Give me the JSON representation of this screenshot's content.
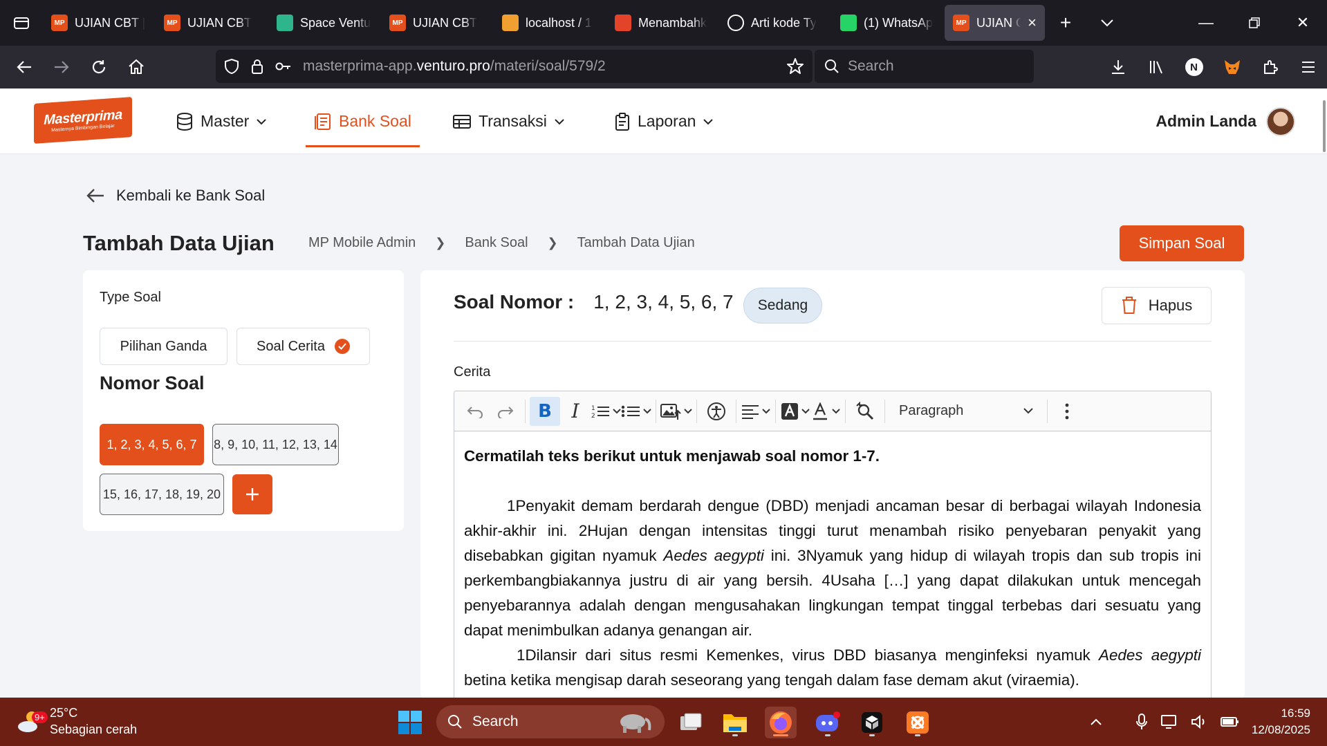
{
  "browser": {
    "tabs": [
      {
        "title": "UJIAN CBT |",
        "icon": "mp-favicon",
        "color": "#e3501b",
        "active": false
      },
      {
        "title": "UJIAN CBT",
        "icon": "mp-favicon",
        "color": "#e3501b",
        "active": false
      },
      {
        "title": "Space Ventu",
        "icon": "space-favicon",
        "color": "#2fb58c",
        "active": false
      },
      {
        "title": "UJIAN CBT",
        "icon": "mp-favicon",
        "color": "#e3501b",
        "active": false
      },
      {
        "title": "localhost / 1",
        "icon": "phpmyadmin-favicon",
        "color": "#f0a030",
        "active": false
      },
      {
        "title": "Menambahk",
        "icon": "gitlab-favicon",
        "color": "#e24329",
        "active": false
      },
      {
        "title": "Arti kode Ty",
        "icon": "openai-favicon",
        "color": "#ffffff",
        "active": false
      },
      {
        "title": "(1) WhatsAp",
        "icon": "whatsapp-favicon",
        "color": "#25d366",
        "active": false
      },
      {
        "title": "UJIAN CBT",
        "icon": "mp-favicon",
        "color": "#e3501b",
        "active": true
      }
    ],
    "url_host": "masterprima-app.",
    "url_domain": "venturo.pro",
    "url_path": "/materi/soal/579/2",
    "search_placeholder": "Search"
  },
  "app": {
    "logo_text": "Masterprima",
    "logo_tagline": "Masternya Bimbingan Belajar",
    "menu": [
      {
        "label": "Master",
        "icon": "database-icon",
        "has_dropdown": true
      },
      {
        "label": "Bank Soal",
        "icon": "document-icon",
        "active": true
      },
      {
        "label": "Transaksi",
        "icon": "table-icon",
        "has_dropdown": true
      },
      {
        "label": "Laporan",
        "icon": "clipboard-icon",
        "has_dropdown": true
      }
    ],
    "user_name": "Admin Landa",
    "accent": "#e3501b"
  },
  "page": {
    "back_label": "Kembali ke Bank Soal",
    "title": "Tambah Data Ujian",
    "breadcrumb": [
      "MP Mobile Admin",
      "Bank Soal",
      "Tambah Data Ujian"
    ],
    "save_label": "Simpan Soal"
  },
  "left": {
    "type_label": "Type Soal",
    "type_options": [
      {
        "label": "Pilihan Ganda",
        "selected": false
      },
      {
        "label": "Soal Cerita",
        "selected": true
      }
    ],
    "nomor_title": "Nomor Soal",
    "groups": [
      {
        "label": "1, 2, 3, 4, 5, 6, 7",
        "active": true
      },
      {
        "label": "8, 9, 10, 11, 12, 13, 14",
        "active": false
      },
      {
        "label": "15, 16, 17, 18, 19, 20",
        "active": false
      }
    ]
  },
  "right": {
    "soal_label": "Soal Nomor :",
    "soal_numbers": "1, 2, 3, 4, 5, 6, 7",
    "difficulty": "Sedang",
    "delete_label": "Hapus",
    "cerita_label": "Cerita",
    "paragraph_style": "Paragraph",
    "lead": "Cermatilah teks berikut untuk menjawab soal nomor 1-7.",
    "p1_a": "1Penyakit demam berdarah dengue (DBD) menjadi ancaman besar di berbagai wilayah Indonesia akhir-akhir ini. 2Hujan dengan intensitas tinggi turut menambah risiko penyebaran penyakit yang disebabkan gigitan nyamuk ",
    "p1_italic": "Aedes aegypti",
    "p1_b": " ini. 3Nyamuk yang hidup di wilayah tropis dan sub tropis ini perkembangbiakannya justru di air yang bersih. 4Usaha […] yang dapat dilakukan untuk mencegah penyebarannya adalah dengan mengusahakan lingkungan tempat tinggal terbebas dari sesuatu yang dapat menimbulkan adanya genangan air.",
    "p2_a": "1Dilansir dari situs resmi Kemenkes, virus DBD biasanya menginfeksi nyamuk ",
    "p2_italic": "Aedes aegypti",
    "p2_b": " betina ketika mengisap darah seseorang yang tengah dalam fase demam akut (viraemia)."
  },
  "taskbar": {
    "temperature": "25°C",
    "weather": "Sebagian cerah",
    "weather_badge": "9+",
    "search_label": "Search",
    "time": "16:59",
    "date": "12/08/2025"
  }
}
